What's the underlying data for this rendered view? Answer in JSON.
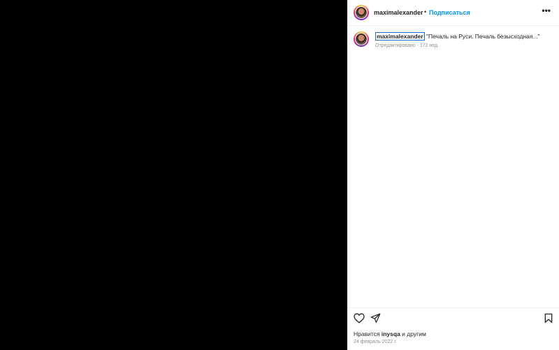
{
  "post": {
    "username": "maximalexander",
    "dot": "•",
    "follow_label": "Подписаться",
    "more_label": "•••"
  },
  "caption": {
    "username": "maximalexander",
    "text": " \"Печаль на Руси. Печаль безысходная...\"",
    "meta": "Отредактировано · 172 нед."
  },
  "footer": {
    "likes_prefix": "Нравится ",
    "likes_user": "inysqa",
    "likes_suffix": " и другим",
    "date": "24 февраль 2022 г."
  }
}
